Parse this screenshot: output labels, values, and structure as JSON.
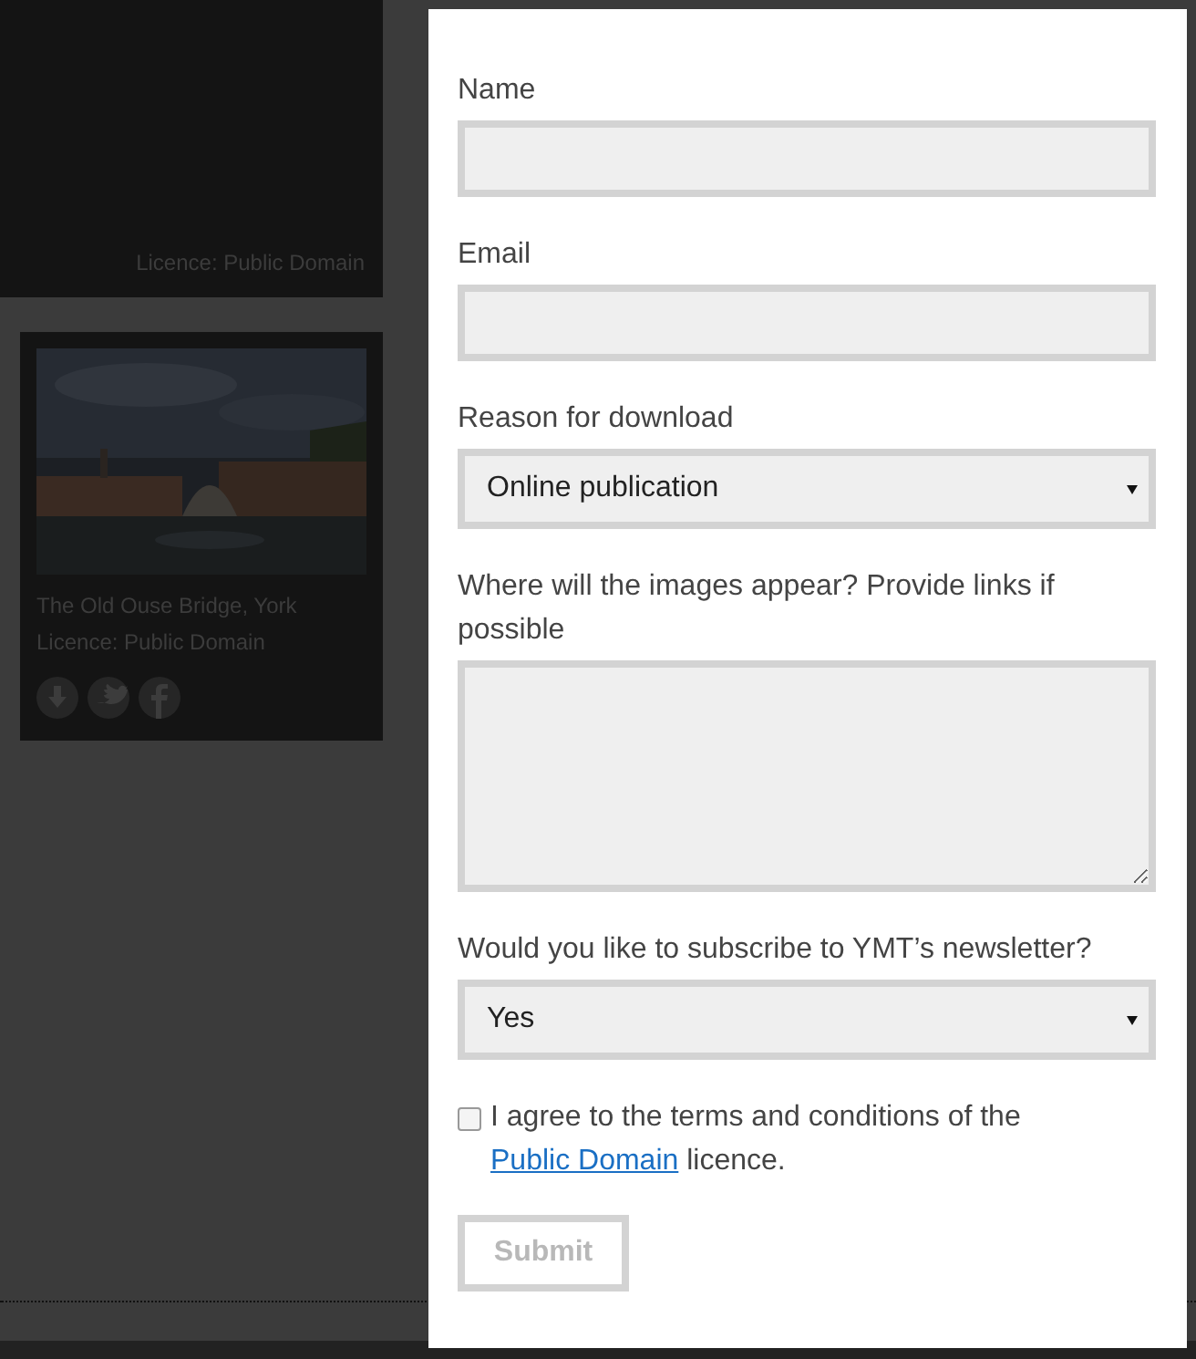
{
  "background": {
    "cards": [
      {
        "kind": "cut",
        "licence": "Licence: Public Domain"
      },
      {
        "kind": "full",
        "title": "The Old Ouse Bridge, York",
        "licence": "Licence: Public Domain"
      }
    ]
  },
  "form": {
    "fields": [
      {
        "kind": "text",
        "label": "Name"
      },
      {
        "kind": "text",
        "label": "Email"
      },
      {
        "kind": "select",
        "label": "Reason for download",
        "value": "Online publication"
      },
      {
        "kind": "textarea",
        "label": "Where will the images appear? Provide links if possible"
      },
      {
        "kind": "select",
        "label": "Would you like to subscribe to YMT’s newsletter?",
        "value": "Yes"
      }
    ],
    "agreement": {
      "checked": false,
      "before": "I agree to the terms and conditions of the ",
      "link": "Public Domain",
      "after": " licence."
    },
    "submit": {
      "label": "Submit",
      "disabled": true
    }
  }
}
